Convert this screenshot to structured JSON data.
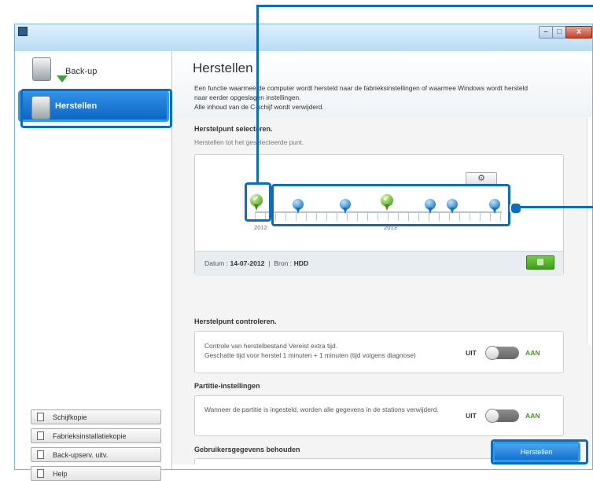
{
  "window": {
    "controls": {
      "minimize": "–",
      "maximize": "□",
      "close": "x"
    }
  },
  "sidebar": {
    "items": [
      {
        "label": "Back-up",
        "icon": "backup-drive-icon"
      },
      {
        "label": "Herstellen",
        "icon": "restore-drive-icon",
        "selected": true
      }
    ],
    "buttons": [
      {
        "label": "Schijfkopie",
        "icon": "disk-copy-icon"
      },
      {
        "label": "Fabrieksinstallatiekopie",
        "icon": "factory-copy-icon"
      },
      {
        "label": "Back-upserv. uitv.",
        "icon": "backup-service-icon"
      },
      {
        "label": "Help",
        "icon": "help-icon"
      }
    ]
  },
  "main": {
    "title": "Herstellen",
    "description": [
      "Een functie waarmee de computer wordt hersteld naar de fabrieksinstellingen of waarmee Windows wordt hersteld",
      "naar eerder opgeslagen instellingen.",
      "Alle inhoud van de C-schijf wordt verwijderd."
    ],
    "restore_point": {
      "title": "Herstelpunt selecteren.",
      "subtitle": "Herstellen tot het geselecteerde punt.",
      "years": [
        "2012",
        "2013"
      ],
      "footer": {
        "date_label": "Datum :",
        "date_value": "14-07-2012",
        "separator": "|",
        "source_label": "Bron :",
        "source_value": "HDD"
      }
    },
    "check": {
      "title": "Herstelpunt controleren.",
      "line1": "Controle van herstelbestand Vereist extra tijd.",
      "line2": "Geschatte tijd voor herstel 1 minuten + 1 minuten (tijd volgens diagnose)",
      "off": "UIT",
      "on": "AAN"
    },
    "partition": {
      "title": "Partitie-instellingen",
      "text": "Wanneer de partitie is ingesteld, worden alle gegevens in de stations verwijderd.",
      "off": "UIT",
      "on": "AAN"
    },
    "keep_data": {
      "title": "Gebruikersgegevens behouden"
    },
    "restore_button": "Herstellen"
  },
  "colors": {
    "accent": "#0c6cc0",
    "selected_nav": "#1b78d4",
    "toggle_on_text": "#3d9a1c",
    "pin_blue": "#2a88d4",
    "pin_green": "#5fb32e"
  }
}
